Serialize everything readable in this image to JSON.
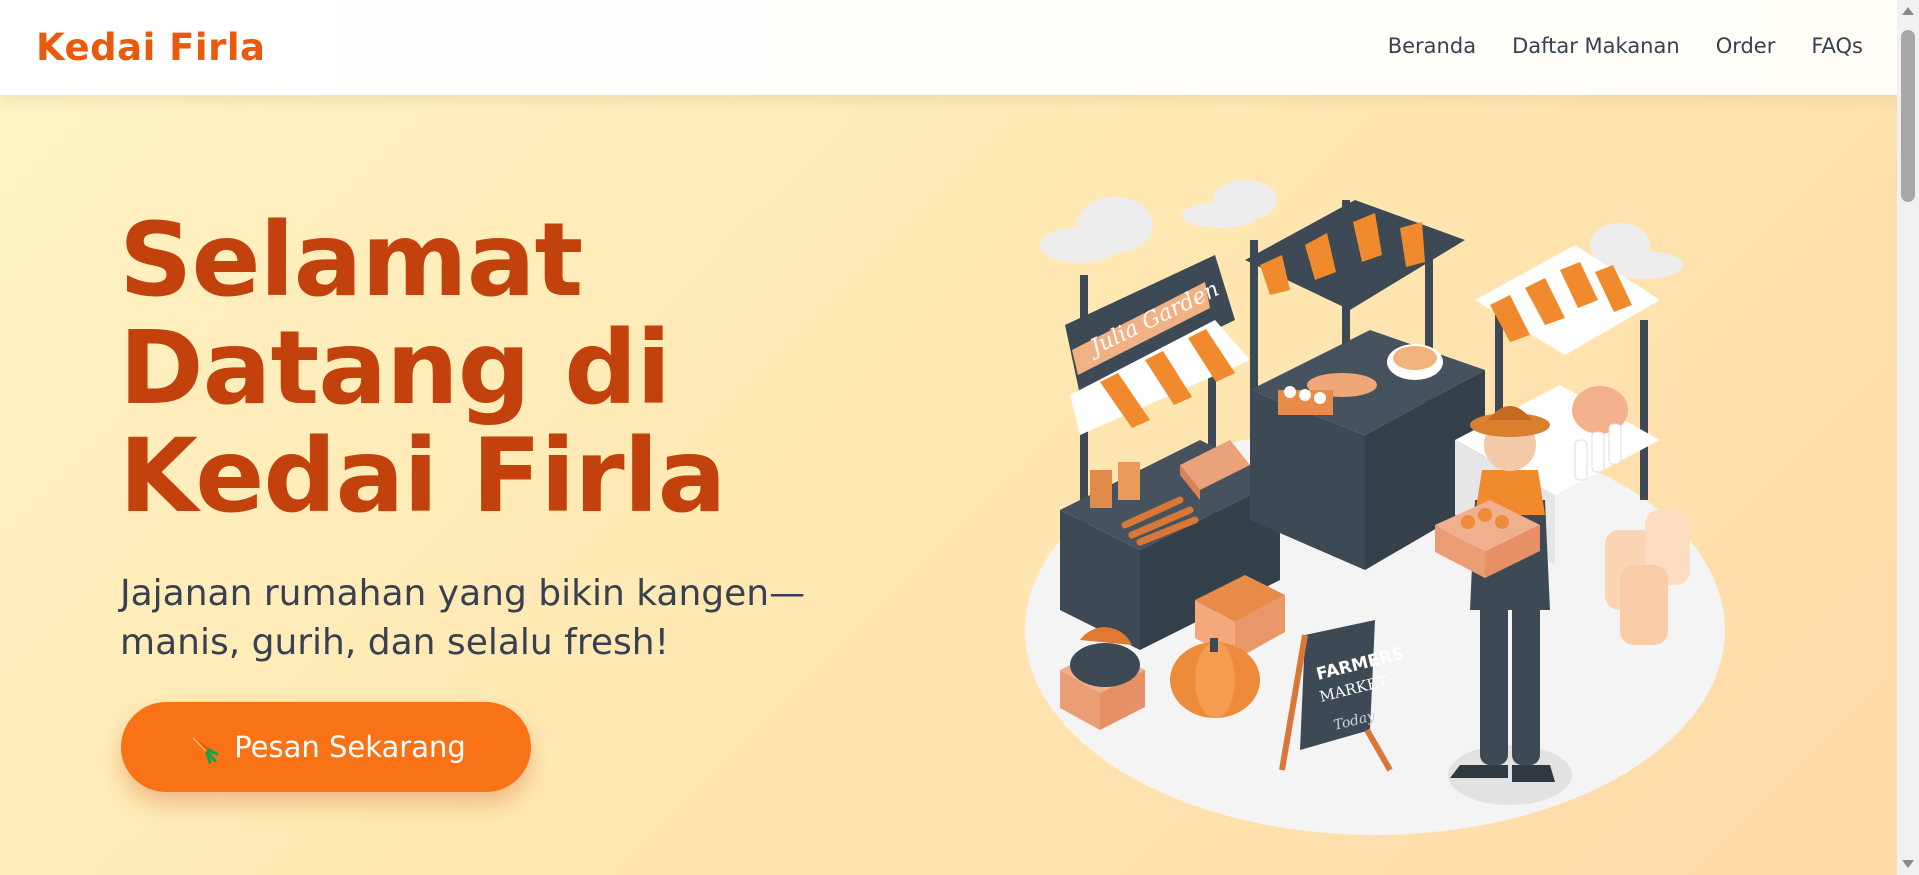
{
  "brand": "Kedai Firla",
  "nav": {
    "items": [
      {
        "label": "Beranda"
      },
      {
        "label": "Daftar Makanan"
      },
      {
        "label": "Order"
      },
      {
        "label": "FAQs"
      }
    ]
  },
  "hero": {
    "title": "Selamat Datang di Kedai Firla",
    "subtitle": "Jajanan rumahan yang bikin kangen—manis, gurih, dan selalu fresh!",
    "cta_label": "Pesan Sekarang",
    "cta_icon": "carrot-icon"
  },
  "illustration": {
    "stall_sign": "Julia Garden",
    "board_line1": "FARMERS",
    "board_line2": "MARKET",
    "board_line3": "Today"
  },
  "colors": {
    "brand": "#ea5a0c",
    "title": "#c2410c",
    "accent": "#f97316",
    "text": "#374151",
    "stall_dark": "#3d4a55"
  }
}
